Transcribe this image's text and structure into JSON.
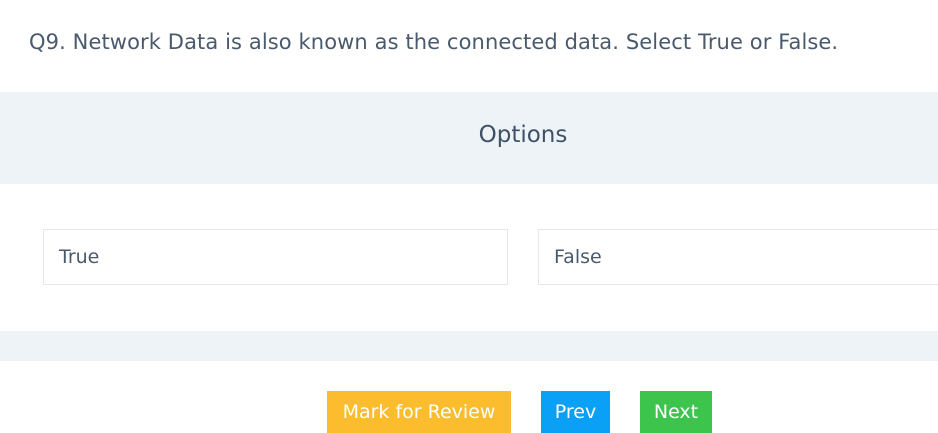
{
  "question": {
    "text": "Q9. Network Data is also known as the connected data. Select True or False."
  },
  "options_section": {
    "title": "Options",
    "items": [
      {
        "label": "True"
      },
      {
        "label": "False"
      }
    ]
  },
  "buttons": {
    "mark_for_review": {
      "label": "Mark for Review",
      "color": "#fbbd2e"
    },
    "prev": {
      "label": "Prev",
      "color": "#0aa0f5"
    },
    "next": {
      "label": "Next",
      "color": "#3cc44c"
    }
  },
  "colors": {
    "band_background": "#eef3f8",
    "text": "#4a5a6d"
  }
}
